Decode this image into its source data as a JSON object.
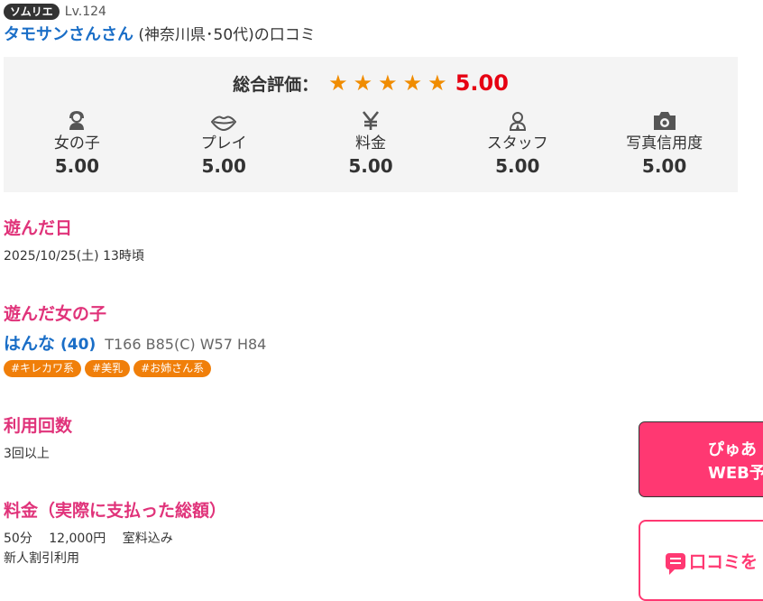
{
  "reviewer": {
    "rank_badge": "ソムリエ",
    "level": "Lv.124",
    "name": "タモサンさんさん",
    "info": " (神奈川県･50代)の口コミ"
  },
  "rating": {
    "overall_label": "総合評価：",
    "stars": [
      "★",
      "★",
      "★",
      "★",
      "★"
    ],
    "overall_score": "5.00",
    "star_color": "#f08c00",
    "score_color": "#e60012",
    "categories": [
      {
        "icon": "woman-icon",
        "label": "女の子",
        "value": "5.00"
      },
      {
        "icon": "lips-icon",
        "label": "プレイ",
        "value": "5.00"
      },
      {
        "icon": "yen-icon",
        "label": "料金",
        "value": "5.00"
      },
      {
        "icon": "staff-icon",
        "label": "スタッフ",
        "value": "5.00"
      },
      {
        "icon": "camera-icon",
        "label": "写真信用度",
        "value": "5.00"
      }
    ]
  },
  "visit_date": {
    "title": "遊んだ日",
    "value": "2025/10/25(土) 13時頃"
  },
  "girl": {
    "title": "遊んだ女の子",
    "name": "はんな",
    "age": "(40)",
    "specs": "T166 B85(C) W57 H84",
    "tags": [
      "#キレカワ系",
      "#美乳",
      "#お姉さん系"
    ]
  },
  "usage_count": {
    "title": "利用回数",
    "value": "3回以上"
  },
  "price": {
    "title": "料金（実際に支払った総額）",
    "detail": "50分　 12,000円　 室料込み",
    "note": "新人割引利用"
  },
  "cta": {
    "reserve_line1": "ぴゅあ",
    "reserve_line2": "WEB予",
    "review_label": "口コミを"
  },
  "colors": {
    "accent": "#e0337a",
    "link": "#1a6ec7",
    "tag": "#f07f0a",
    "cta": "#ff3872"
  }
}
